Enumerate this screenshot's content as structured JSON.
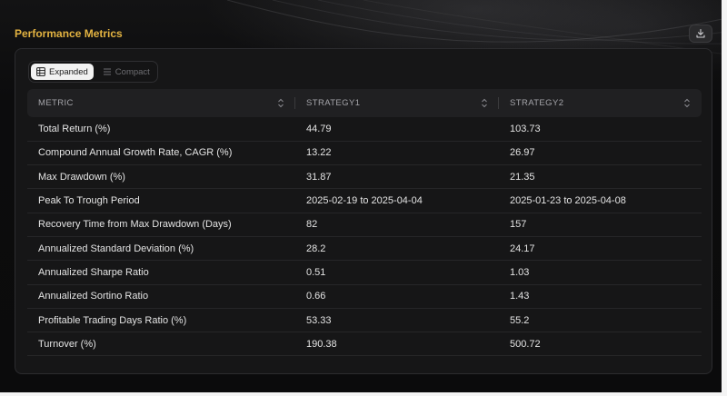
{
  "header": {
    "title": "Performance Metrics",
    "download_icon": "download-icon"
  },
  "view_toggle": {
    "expanded_label": "Expanded",
    "expanded_icon": "table-icon",
    "compact_label": "Compact",
    "compact_icon": "list-icon",
    "selected": "Expanded"
  },
  "table": {
    "columns": [
      "METRIC",
      "STRATEGY1",
      "STRATEGY2"
    ],
    "rows": [
      [
        "Total Return (%)",
        "44.79",
        "103.73"
      ],
      [
        "Compound Annual Growth Rate, CAGR (%)",
        "13.22",
        "26.97"
      ],
      [
        "Max Drawdown (%)",
        "31.87",
        "21.35"
      ],
      [
        "Peak To Trough Period",
        "2025-02-19 to 2025-04-04",
        "2025-01-23 to 2025-04-08"
      ],
      [
        "Recovery Time from Max Drawdown (Days)",
        "82",
        "157"
      ],
      [
        "Annualized Standard Deviation (%)",
        "28.2",
        "24.17"
      ],
      [
        "Annualized Sharpe Ratio",
        "0.51",
        "1.03"
      ],
      [
        "Annualized Sortino Ratio",
        "0.66",
        "1.43"
      ],
      [
        "Profitable Trading Days Ratio (%)",
        "53.33",
        "55.2"
      ],
      [
        "Turnover (%)",
        "190.38",
        "500.72"
      ]
    ]
  },
  "colors": {
    "accent": "#e3b341",
    "background": "#0b0b0c",
    "panel": "#161617"
  }
}
